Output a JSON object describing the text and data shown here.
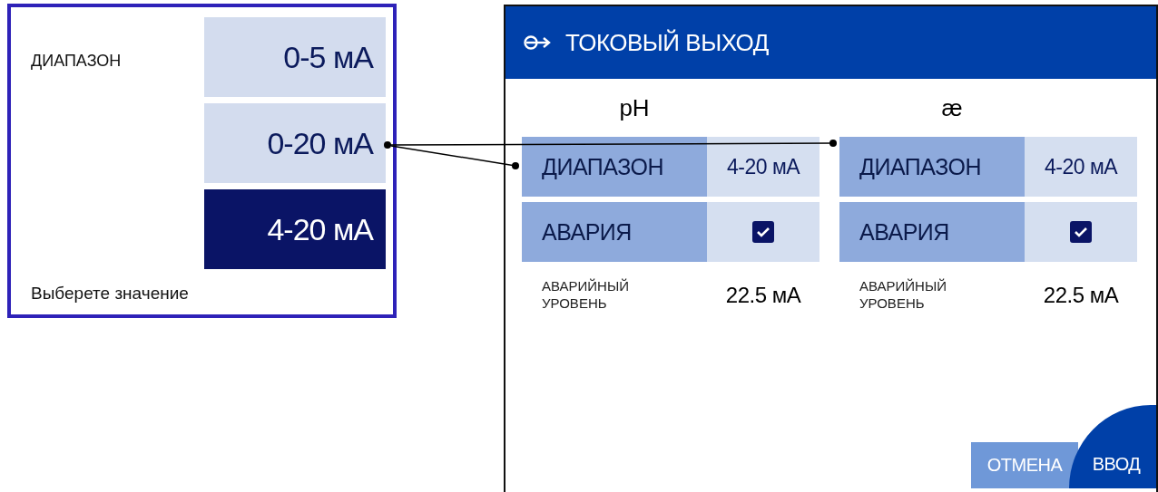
{
  "popup": {
    "label": "ДИАПАЗОН",
    "options": [
      {
        "text": "0-5 мА",
        "selected": false
      },
      {
        "text": "0-20 мА",
        "selected": false
      },
      {
        "text": "4-20 мА",
        "selected": true
      }
    ],
    "hint": "Выберете значение"
  },
  "screen": {
    "title": "ТОКОВЫЙ ВЫХОД",
    "channels": [
      {
        "name": "pH",
        "range_label": "ДИАПАЗОН",
        "range_value": "4-20 мА",
        "alarm_label": "АВАРИЯ",
        "alarm_checked": true,
        "level_label": "АВАРИЙНЫЙ УРОВЕНЬ",
        "level_value": "22.5 мА"
      },
      {
        "name": "æ",
        "range_label": "ДИАПАЗОН",
        "range_value": "4-20 мА",
        "alarm_label": "АВАРИЯ",
        "alarm_checked": true,
        "level_label": "АВАРИЙНЫЙ УРОВЕНЬ",
        "level_value": "22.5 мА"
      }
    ],
    "buttons": [
      {
        "label": "ОТМЕНА",
        "kind": "cancel"
      },
      {
        "label": "ВВОД",
        "kind": "confirm"
      }
    ]
  }
}
